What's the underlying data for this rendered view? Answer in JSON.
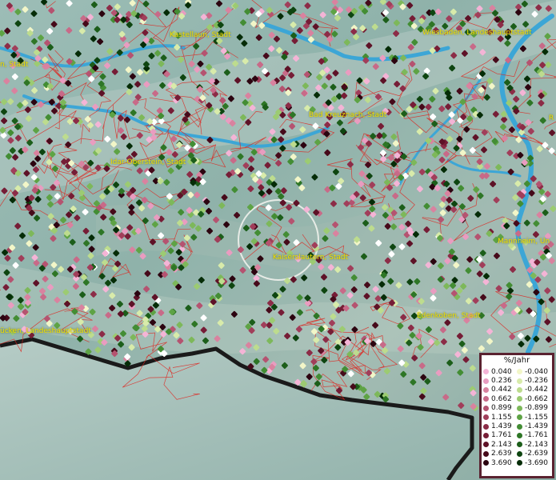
{
  "cities": [
    {
      "id": "kastellaun",
      "label": "Kastellaun, Stadt"
    },
    {
      "id": "wiesbaden",
      "label": "Wiesbaden, Landeshauptstadt"
    },
    {
      "id": "stadt-left",
      "label": "n, Stadt"
    },
    {
      "id": "bad-kreuznach",
      "label": "Bad Kreuznach, Stadt"
    },
    {
      "id": "idar-oberstein",
      "label": "Idar-Oberstein, Stadt"
    },
    {
      "id": "kaiserslautern",
      "label": "Kaiserslautern, Stadt"
    },
    {
      "id": "mannheim",
      "label": "Mannheim, Un"
    },
    {
      "id": "saarbruecken",
      "label": "ücken, Landeshauptstadt"
    },
    {
      "id": "edenkoben",
      "label": "Edenkoben, Stadt"
    },
    {
      "id": "right-edge",
      "label": "R"
    }
  ],
  "legend": {
    "title": "%/Jahr",
    "positive": [
      {
        "value": "0.040",
        "color": "#f4b4d6"
      },
      {
        "value": "0.236",
        "color": "#e99cc0"
      },
      {
        "value": "0.442",
        "color": "#d9829f"
      },
      {
        "value": "0.662",
        "color": "#c86a88"
      },
      {
        "value": "0.899",
        "color": "#b55370"
      },
      {
        "value": "1.155",
        "color": "#a13e5a"
      },
      {
        "value": "1.439",
        "color": "#8c2c47"
      },
      {
        "value": "1.761",
        "color": "#761d36"
      },
      {
        "value": "2.143",
        "color": "#5e1227"
      },
      {
        "value": "2.639",
        "color": "#460a1a"
      },
      {
        "value": "3.690",
        "color": "#2c0410"
      }
    ],
    "negative": [
      {
        "value": "-0.040",
        "color": "#f2f6c8"
      },
      {
        "value": "-0.236",
        "color": "#d8ebaa"
      },
      {
        "value": "-0.442",
        "color": "#bddc8e"
      },
      {
        "value": "-0.662",
        "color": "#9ccb72"
      },
      {
        "value": "-0.899",
        "color": "#7db85a"
      },
      {
        "value": "-1.155",
        "color": "#5ea345"
      },
      {
        "value": "-1.439",
        "color": "#438d34"
      },
      {
        "value": "-1.761",
        "color": "#2e7626"
      },
      {
        "value": "-2.143",
        "color": "#1c5e1a"
      },
      {
        "value": "-2.639",
        "color": "#0e4510"
      },
      {
        "value": "-3.690",
        "color": "#052c07"
      }
    ]
  },
  "colors": {
    "boundary": "#e0201a",
    "river": "#3ca6d6",
    "label": "#f0e000",
    "legend_frame": "#5a2230",
    "white_point": "#ffffff"
  }
}
